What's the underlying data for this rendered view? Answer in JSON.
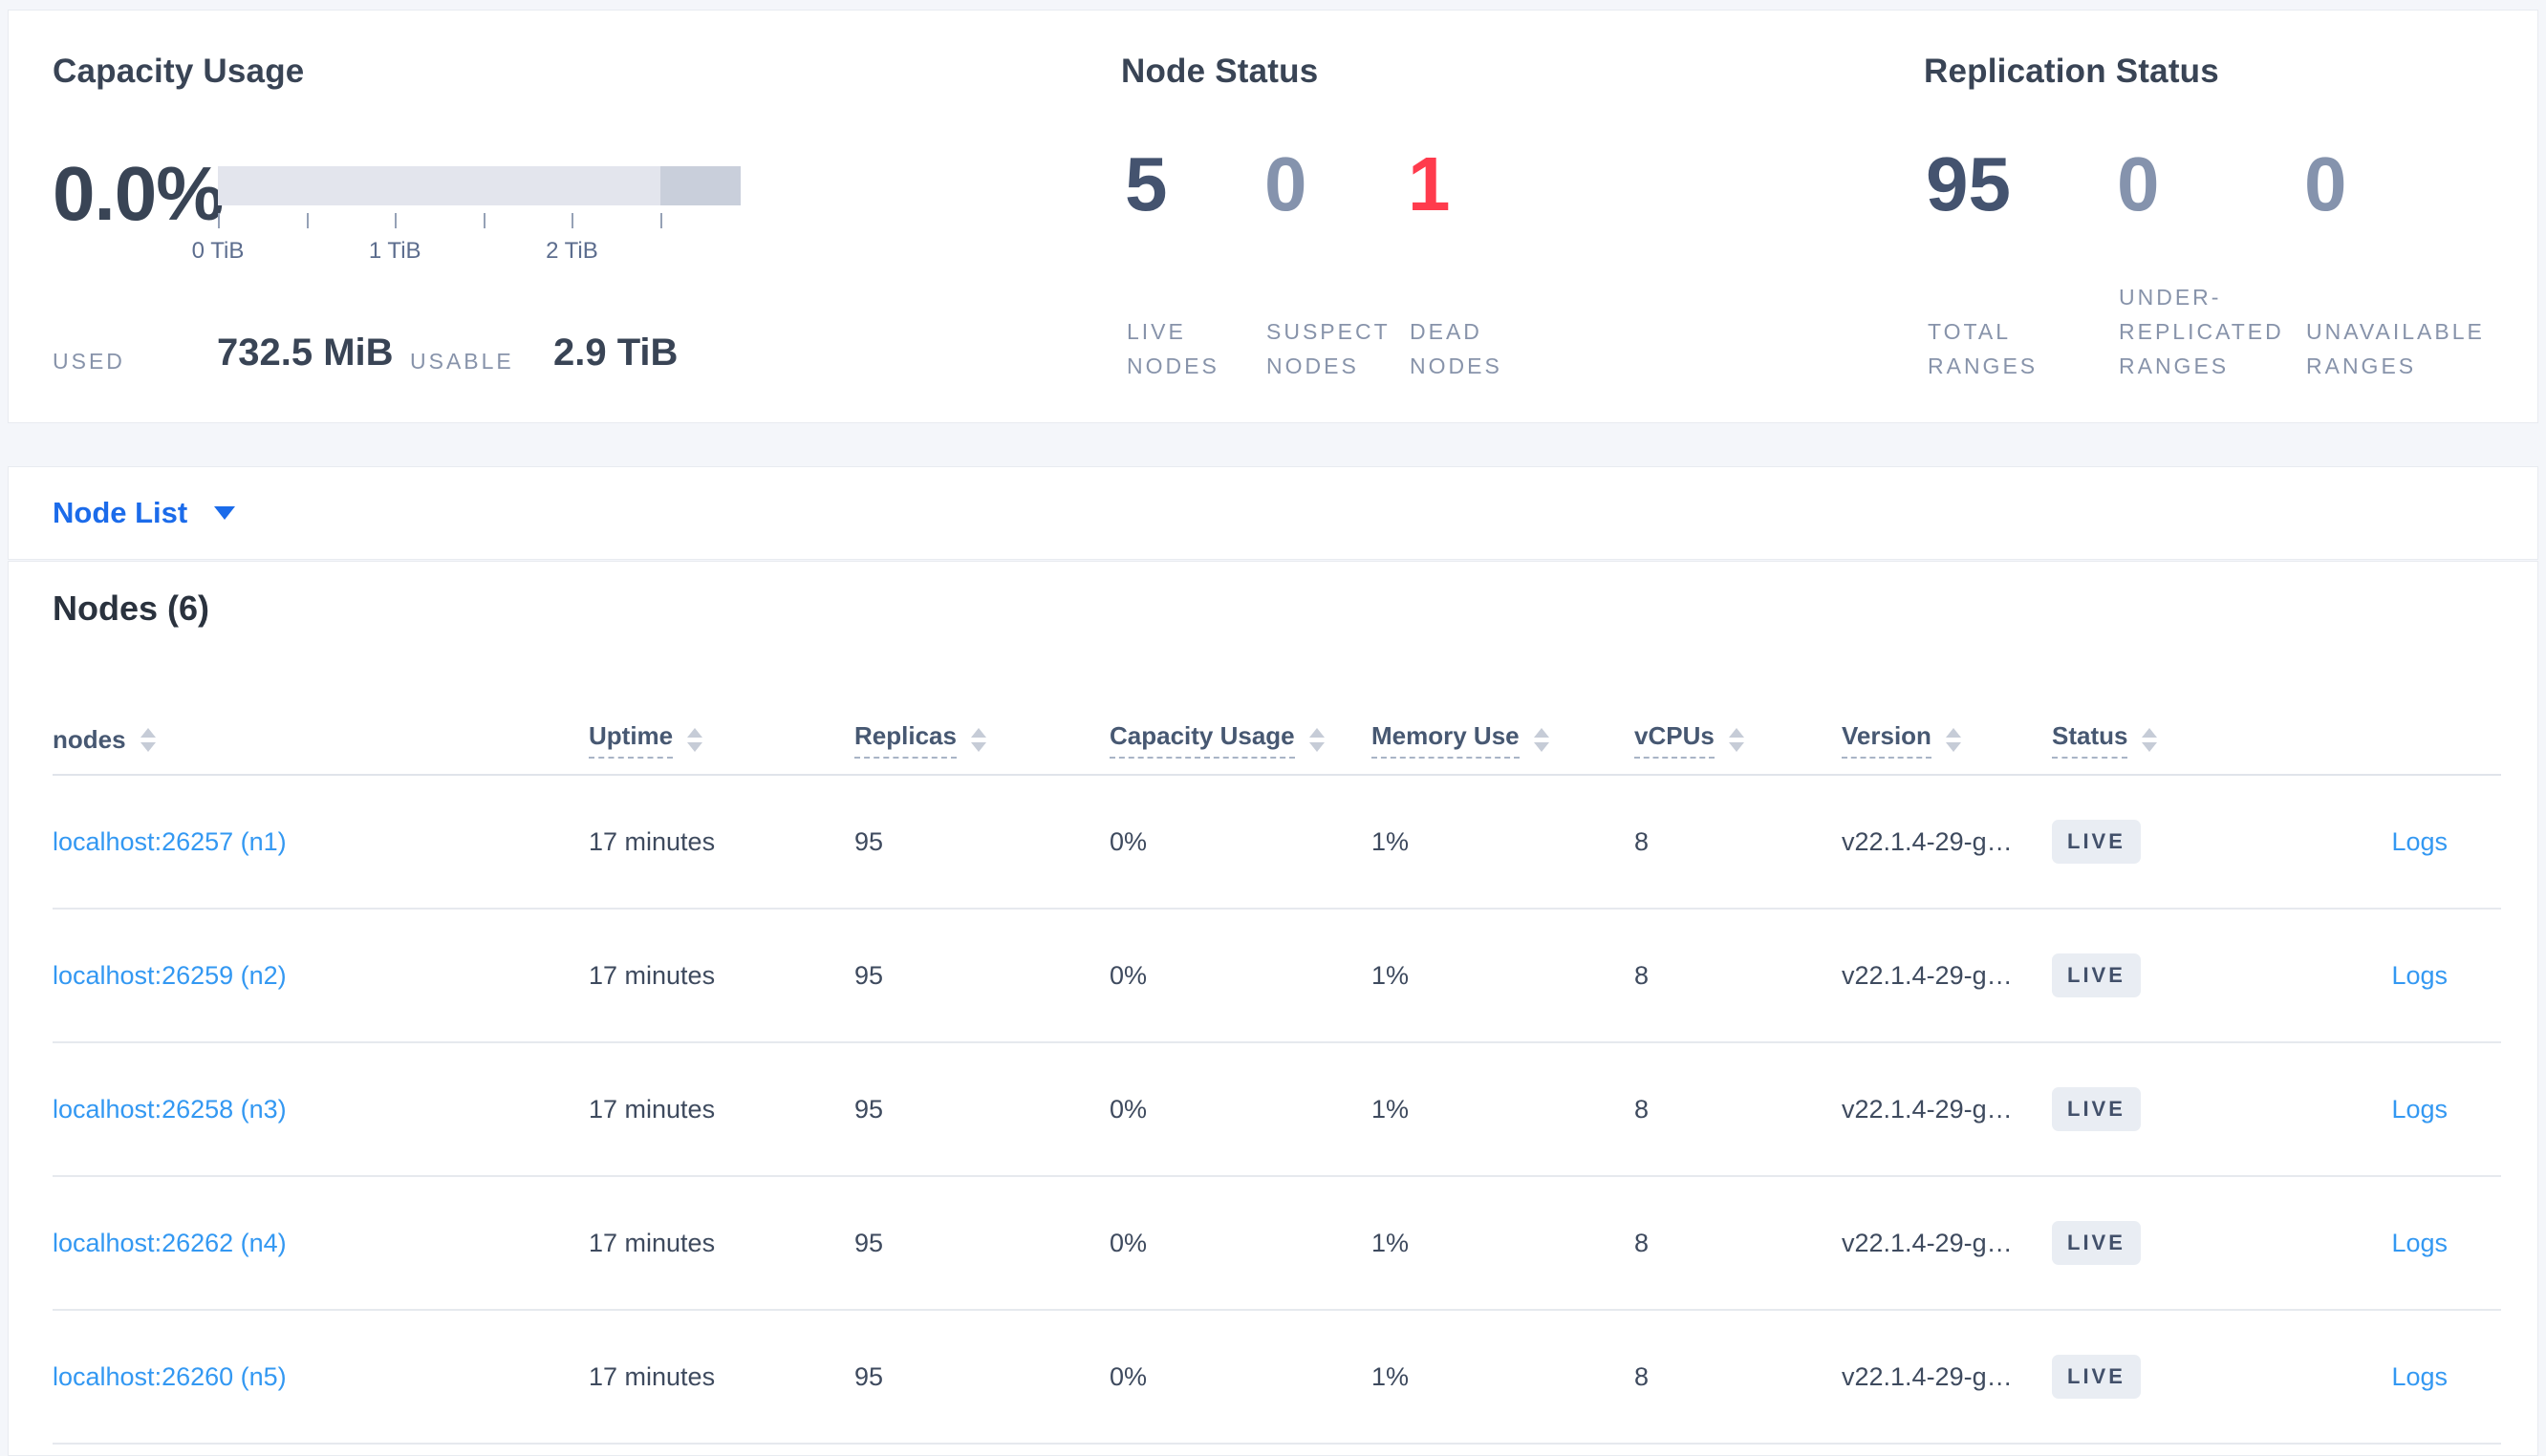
{
  "colors": {
    "accent_blue": "#1b6bea",
    "link_blue": "#3398f2",
    "dead_red": "#ff3b4d",
    "dark_text": "#394455",
    "muted_text": "#8793aa",
    "badge_bg": "#e9edf3",
    "bar_light": "#e3e5ed",
    "bar_dark": "#c9cfdb"
  },
  "summary": {
    "capacity": {
      "title": "Capacity Usage",
      "percent": "0.0%",
      "bar": {
        "segments": [
          {
            "name": "usable",
            "width_pct": 84.7
          },
          {
            "name": "other",
            "width_pct": 15.3
          }
        ],
        "tick_count": 6,
        "tick_step_pct": 16.93,
        "tick_labels": [
          "0 TiB",
          "1 TiB",
          "2 TiB"
        ]
      },
      "stats": [
        {
          "label": "USED",
          "value": "732.5 MiB"
        },
        {
          "label": "USABLE",
          "value": "2.9 TiB"
        }
      ]
    },
    "node_status": {
      "title": "Node Status",
      "metrics": [
        {
          "value": "5",
          "tone": "dark",
          "label_lines": [
            "LIVE",
            "NODES"
          ]
        },
        {
          "value": "0",
          "tone": "light",
          "label_lines": [
            "SUSPECT",
            "NODES"
          ]
        },
        {
          "value": "1",
          "tone": "red",
          "label_lines": [
            "DEAD",
            "NODES"
          ]
        }
      ]
    },
    "replication_status": {
      "title": "Replication Status",
      "metrics": [
        {
          "value": "95",
          "tone": "dark",
          "label_lines": [
            "TOTAL",
            "RANGES"
          ]
        },
        {
          "value": "0",
          "tone": "light",
          "label_lines": [
            "UNDER-",
            "REPLICATED",
            "RANGES"
          ]
        },
        {
          "value": "0",
          "tone": "light",
          "label_lines": [
            "UNAVAILABLE",
            "RANGES"
          ]
        }
      ]
    }
  },
  "view_selector": {
    "label": "Node List"
  },
  "nodes": {
    "title": "Nodes (6)",
    "columns": [
      {
        "label": "nodes",
        "dotted": false
      },
      {
        "label": "Uptime",
        "dotted": true
      },
      {
        "label": "Replicas",
        "dotted": true
      },
      {
        "label": "Capacity Usage",
        "dotted": true
      },
      {
        "label": "Memory Use",
        "dotted": true
      },
      {
        "label": "vCPUs",
        "dotted": true
      },
      {
        "label": "Version",
        "dotted": true
      },
      {
        "label": "Status",
        "dotted": true
      }
    ],
    "rows": [
      {
        "address": "localhost:26257 (n1)",
        "uptime": "17 minutes",
        "replicas": "95",
        "capacity_usage": "0%",
        "memory_use": "1%",
        "vcpus": "8",
        "version": "v22.1.4-29-g…",
        "status": "LIVE",
        "logs": "Logs"
      },
      {
        "address": "localhost:26259 (n2)",
        "uptime": "17 minutes",
        "replicas": "95",
        "capacity_usage": "0%",
        "memory_use": "1%",
        "vcpus": "8",
        "version": "v22.1.4-29-g…",
        "status": "LIVE",
        "logs": "Logs"
      },
      {
        "address": "localhost:26258 (n3)",
        "uptime": "17 minutes",
        "replicas": "95",
        "capacity_usage": "0%",
        "memory_use": "1%",
        "vcpus": "8",
        "version": "v22.1.4-29-g…",
        "status": "LIVE",
        "logs": "Logs"
      },
      {
        "address": "localhost:26262 (n4)",
        "uptime": "17 minutes",
        "replicas": "95",
        "capacity_usage": "0%",
        "memory_use": "1%",
        "vcpus": "8",
        "version": "v22.1.4-29-g…",
        "status": "LIVE",
        "logs": "Logs"
      },
      {
        "address": "localhost:26260 (n5)",
        "uptime": "17 minutes",
        "replicas": "95",
        "capacity_usage": "0%",
        "memory_use": "1%",
        "vcpus": "8",
        "version": "v22.1.4-29-g…",
        "status": "LIVE",
        "logs": "Logs"
      }
    ]
  }
}
